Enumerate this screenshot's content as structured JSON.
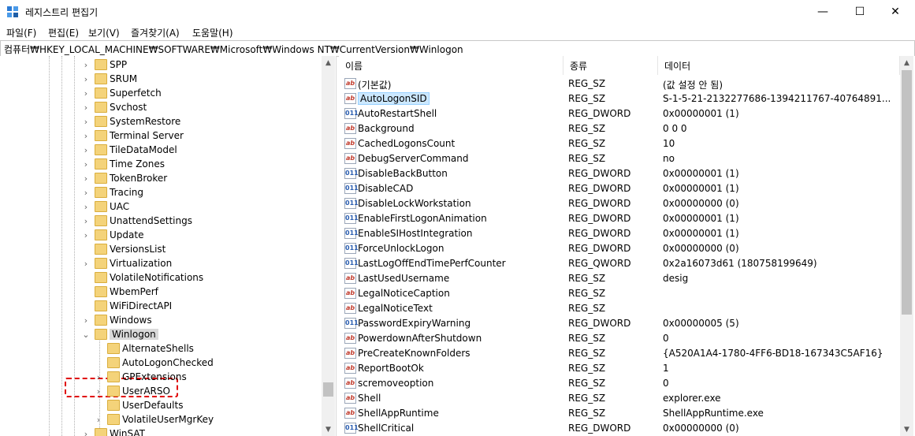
{
  "window": {
    "title": "레지스트리 편집기",
    "minimize": "—",
    "maximize": "☐",
    "close": "✕"
  },
  "menu": [
    "파일(F)",
    "편집(E)",
    "보기(V)",
    "즐겨찾기(A)",
    "도움말(H)"
  ],
  "address": "컴퓨터₩HKEY_LOCAL_MACHINE₩SOFTWARE₩Microsoft₩Windows NT₩CurrentVersion₩Winlogon",
  "tree": [
    {
      "label": "SPP",
      "chevron": "›",
      "level": 1
    },
    {
      "label": "SRUM",
      "chevron": "›",
      "level": 1
    },
    {
      "label": "Superfetch",
      "chevron": "›",
      "level": 1
    },
    {
      "label": "Svchost",
      "chevron": "›",
      "level": 1
    },
    {
      "label": "SystemRestore",
      "chevron": "›",
      "level": 1
    },
    {
      "label": "Terminal Server",
      "chevron": "›",
      "level": 1
    },
    {
      "label": "TileDataModel",
      "chevron": "›",
      "level": 1
    },
    {
      "label": "Time Zones",
      "chevron": "›",
      "level": 1
    },
    {
      "label": "TokenBroker",
      "chevron": "›",
      "level": 1
    },
    {
      "label": "Tracing",
      "chevron": "›",
      "level": 1
    },
    {
      "label": "UAC",
      "chevron": "›",
      "level": 1
    },
    {
      "label": "UnattendSettings",
      "chevron": "›",
      "level": 1
    },
    {
      "label": "Update",
      "chevron": "›",
      "level": 1
    },
    {
      "label": "VersionsList",
      "chevron": "",
      "level": 1
    },
    {
      "label": "Virtualization",
      "chevron": "›",
      "level": 1
    },
    {
      "label": "VolatileNotifications",
      "chevron": "",
      "level": 1
    },
    {
      "label": "WbemPerf",
      "chevron": "",
      "level": 1
    },
    {
      "label": "WiFiDirectAPI",
      "chevron": "",
      "level": 1
    },
    {
      "label": "Windows",
      "chevron": "›",
      "level": 1
    },
    {
      "label": "Winlogon",
      "chevron": "⌄",
      "level": 1,
      "selected": true
    },
    {
      "label": "AlternateShells",
      "chevron": "",
      "level": 2
    },
    {
      "label": "AutoLogonChecked",
      "chevron": "",
      "level": 2
    },
    {
      "label": "GPExtensions",
      "chevron": "›",
      "level": 2
    },
    {
      "label": "UserARSO",
      "chevron": "›",
      "level": 2
    },
    {
      "label": "UserDefaults",
      "chevron": "",
      "level": 2
    },
    {
      "label": "VolatileUserMgrKey",
      "chevron": "›",
      "level": 2
    },
    {
      "label": "WinSAT",
      "chevron": "›",
      "level": 1
    }
  ],
  "columns": {
    "name": "이름",
    "type": "종류",
    "data": "데이터"
  },
  "values": [
    {
      "icon": "sz",
      "name": "(기본값)",
      "type": "REG_SZ",
      "data": "(값 설정 안 됨)"
    },
    {
      "icon": "sz",
      "name": "AutoLogonSID",
      "type": "REG_SZ",
      "data": "S-1-5-21-2132277686-1394211767-40764891...",
      "selected": true
    },
    {
      "icon": "num",
      "name": "AutoRestartShell",
      "type": "REG_DWORD",
      "data": "0x00000001 (1)"
    },
    {
      "icon": "sz",
      "name": "Background",
      "type": "REG_SZ",
      "data": "0 0 0"
    },
    {
      "icon": "sz",
      "name": "CachedLogonsCount",
      "type": "REG_SZ",
      "data": "10"
    },
    {
      "icon": "sz",
      "name": "DebugServerCommand",
      "type": "REG_SZ",
      "data": "no"
    },
    {
      "icon": "num",
      "name": "DisableBackButton",
      "type": "REG_DWORD",
      "data": "0x00000001 (1)"
    },
    {
      "icon": "num",
      "name": "DisableCAD",
      "type": "REG_DWORD",
      "data": "0x00000001 (1)"
    },
    {
      "icon": "num",
      "name": "DisableLockWorkstation",
      "type": "REG_DWORD",
      "data": "0x00000000 (0)"
    },
    {
      "icon": "num",
      "name": "EnableFirstLogonAnimation",
      "type": "REG_DWORD",
      "data": "0x00000001 (1)"
    },
    {
      "icon": "num",
      "name": "EnableSIHostIntegration",
      "type": "REG_DWORD",
      "data": "0x00000001 (1)"
    },
    {
      "icon": "num",
      "name": "ForceUnlockLogon",
      "type": "REG_DWORD",
      "data": "0x00000000 (0)"
    },
    {
      "icon": "num",
      "name": "LastLogOffEndTimePerfCounter",
      "type": "REG_QWORD",
      "data": "0x2a16073d61 (180758199649)"
    },
    {
      "icon": "sz",
      "name": "LastUsedUsername",
      "type": "REG_SZ",
      "data": "desig"
    },
    {
      "icon": "sz",
      "name": "LegalNoticeCaption",
      "type": "REG_SZ",
      "data": ""
    },
    {
      "icon": "sz",
      "name": "LegalNoticeText",
      "type": "REG_SZ",
      "data": ""
    },
    {
      "icon": "num",
      "name": "PasswordExpiryWarning",
      "type": "REG_DWORD",
      "data": "0x00000005 (5)"
    },
    {
      "icon": "sz",
      "name": "PowerdownAfterShutdown",
      "type": "REG_SZ",
      "data": "0"
    },
    {
      "icon": "sz",
      "name": "PreCreateKnownFolders",
      "type": "REG_SZ",
      "data": "{A520A1A4-1780-4FF6-BD18-167343C5AF16}"
    },
    {
      "icon": "sz",
      "name": "ReportBootOk",
      "type": "REG_SZ",
      "data": "1"
    },
    {
      "icon": "sz",
      "name": "scremoveoption",
      "type": "REG_SZ",
      "data": "0"
    },
    {
      "icon": "sz",
      "name": "Shell",
      "type": "REG_SZ",
      "data": "explorer.exe"
    },
    {
      "icon": "sz",
      "name": "ShellAppRuntime",
      "type": "REG_SZ",
      "data": "ShellAppRuntime.exe"
    },
    {
      "icon": "num",
      "name": "ShellCritical",
      "type": "REG_DWORD",
      "data": "0x00000000 (0)"
    }
  ],
  "icon_text": {
    "sz": "ab",
    "num": "011"
  },
  "colors": {
    "folder": "#f4d37a",
    "selection": "#cce8ff",
    "highlight": "#e00000"
  }
}
